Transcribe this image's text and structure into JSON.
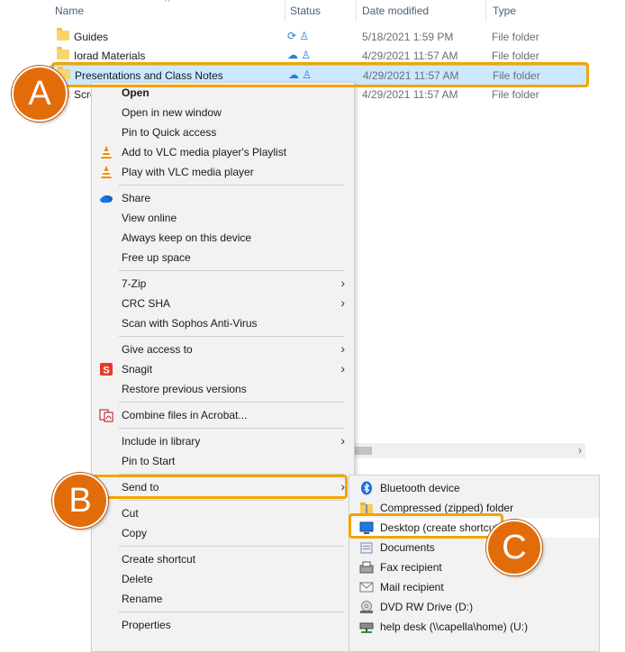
{
  "header": {
    "columns": [
      "Name",
      "Status",
      "Date modified",
      "Type"
    ],
    "sort_indicator": "^"
  },
  "files": [
    {
      "name": "Guides",
      "status": "⟳ ♙",
      "date": "5/18/2021 1:59 PM",
      "type": "File folder"
    },
    {
      "name": "Iorad Materials",
      "status": "☁ ♙",
      "date": "4/29/2021 11:57 AM",
      "type": "File folder"
    },
    {
      "name": "Presentations and Class Notes",
      "status": "☁ ♙",
      "date": "4/29/2021 11:57 AM",
      "type": "File folder"
    },
    {
      "name": "Scre",
      "status": "",
      "date": "4/29/2021 11:57 AM",
      "type": "File folder"
    }
  ],
  "context_menu": {
    "items": [
      {
        "label": "Open",
        "bold": true
      },
      {
        "label": "Open in new window"
      },
      {
        "label": "Pin to Quick access"
      },
      {
        "label": "Add to VLC media player's Playlist",
        "icon": "vlc-icon"
      },
      {
        "label": "Play with VLC media player",
        "icon": "vlc-icon"
      },
      {
        "label": "Share",
        "icon": "onedrive-cloud-icon"
      },
      {
        "label": "View online"
      },
      {
        "label": "Always keep on this device"
      },
      {
        "label": "Free up space"
      },
      {
        "label": "7-Zip",
        "submenu": true
      },
      {
        "label": "CRC SHA",
        "submenu": true
      },
      {
        "label": "Scan with Sophos Anti-Virus"
      },
      {
        "label": "Give access to",
        "submenu": true
      },
      {
        "label": "Snagit",
        "icon": "snagit-icon",
        "submenu": true
      },
      {
        "label": "Restore previous versions"
      },
      {
        "label": "Combine files in Acrobat...",
        "icon": "acrobat-icon"
      },
      {
        "label": "Include in library",
        "submenu": true
      },
      {
        "label": "Pin to Start"
      },
      {
        "label": "Send to",
        "submenu": true
      },
      {
        "label": "Cut"
      },
      {
        "label": "Copy"
      },
      {
        "label": "Create shortcut"
      },
      {
        "label": "Delete"
      },
      {
        "label": "Rename"
      },
      {
        "label": "Properties"
      }
    ]
  },
  "send_to_menu": {
    "items": [
      {
        "label": "Bluetooth device",
        "icon": "bluetooth-icon"
      },
      {
        "label": "Compressed (zipped) folder",
        "icon": "zip-folder-icon"
      },
      {
        "label": "Desktop (create shortcut)",
        "icon": "desktop-icon"
      },
      {
        "label": "Documents",
        "icon": "documents-icon"
      },
      {
        "label": "Fax recipient",
        "icon": "fax-icon"
      },
      {
        "label": "Mail recipient",
        "icon": "mail-icon"
      },
      {
        "label": "DVD RW Drive (D:)",
        "icon": "dvd-drive-icon"
      },
      {
        "label": "help desk (\\\\capella\\home) (U:)",
        "icon": "network-drive-icon"
      }
    ]
  },
  "annotations": {
    "a": "A",
    "b": "B",
    "c": "C"
  },
  "colors": {
    "highlight": "#f2a500",
    "callout": "#e36c0a",
    "selection": "#cce8ff"
  }
}
